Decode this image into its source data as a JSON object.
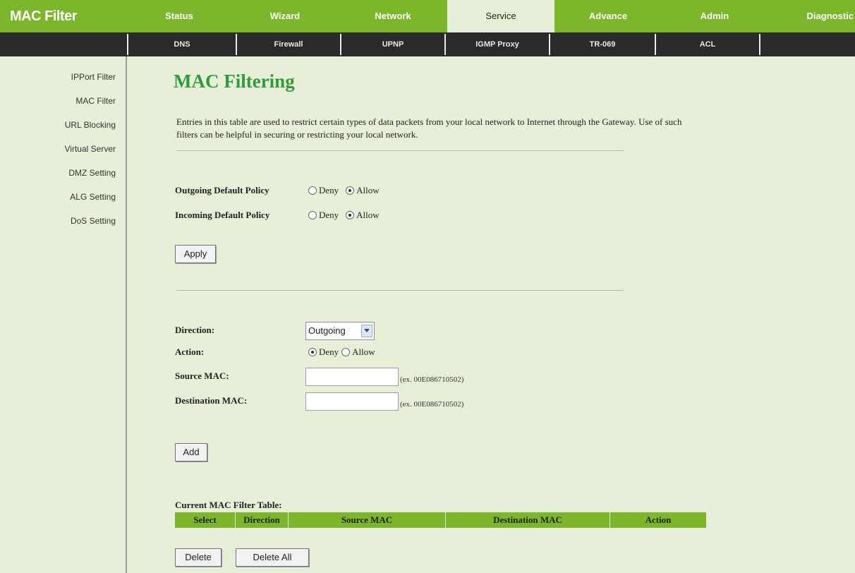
{
  "brand": "MAC Filter",
  "tabs": [
    "Status",
    "Wizard",
    "Network",
    "Service",
    "Advance",
    "Admin",
    "Diagnostic"
  ],
  "active_tab": "Service",
  "subtabs": [
    "DNS",
    "Firewall",
    "UPNP",
    "IGMP Proxy",
    "TR-069",
    "ACL"
  ],
  "sidebar": [
    "IPPort Filter",
    "MAC Filter",
    "URL Blocking",
    "Virtual Server",
    "DMZ Setting",
    "ALG Setting",
    "DoS Setting"
  ],
  "page_title": "MAC Filtering",
  "description": "Entries in this table are used to restrict certain types of data packets from your local network to Internet through the Gateway. Use of such filters can be helpful in securing or restricting your local network.",
  "policy": {
    "outgoing_label": "Outgoing Default Policy",
    "incoming_label": "Incoming Default Policy",
    "deny_label": "Deny",
    "allow_label": "Allow",
    "outgoing_value": "Allow",
    "incoming_value": "Allow"
  },
  "apply_button": "Apply",
  "form": {
    "direction_label": "Direction:",
    "direction_value": "Outgoing",
    "action_label": "Action:",
    "action_deny": "Deny",
    "action_allow": "Allow",
    "action_value": "Deny",
    "source_label": "Source MAC:",
    "source_value": "",
    "dest_label": "Destination MAC:",
    "dest_value": "",
    "hint": "(ex. 00E086710502)"
  },
  "add_button": "Add",
  "table": {
    "title": "Current MAC Filter Table:",
    "headers": [
      "Select",
      "Direction",
      "Source MAC",
      "Destination MAC",
      "Action"
    ]
  },
  "delete_button": "Delete",
  "delete_all_button": "Delete All",
  "colors": {
    "accent_green": "#7cb62a",
    "title_green": "#2e9c38",
    "background": "#e8efd8",
    "subbar": "#2a2a2a"
  }
}
